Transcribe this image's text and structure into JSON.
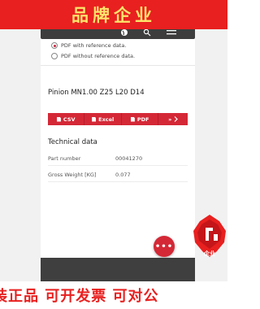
{
  "banner": {
    "top_text": "品牌企业",
    "bottom_text": "装正品  可开发票  可对公"
  },
  "export": {
    "options": [
      {
        "label": "PDF with reference data.",
        "checked": true
      },
      {
        "label": "PDF without reference data.",
        "checked": false
      }
    ]
  },
  "product": {
    "title": "Pinion MN1.00 Z25 L20 D14"
  },
  "download_bar": {
    "buttons": [
      {
        "label": "CSV",
        "icon": "file-icon"
      },
      {
        "label": "Excel",
        "icon": "file-icon"
      },
      {
        "label": "PDF",
        "icon": "file-icon"
      },
      {
        "label": "»",
        "icon": "chevron-right-icon"
      }
    ]
  },
  "technical": {
    "title": "Technical data",
    "rows": [
      {
        "label": "Part number",
        "value": "00041270"
      },
      {
        "label": "Gross Weight [KG]",
        "value": "0.077"
      }
    ]
  },
  "fab": {
    "label": "•••"
  },
  "badge": {
    "text": "企业",
    "color": "#e8201f"
  },
  "colors": {
    "accent": "#d42836",
    "banner": "#e8201f",
    "banner_text": "#ffe46b",
    "header": "#3d3d3d"
  }
}
